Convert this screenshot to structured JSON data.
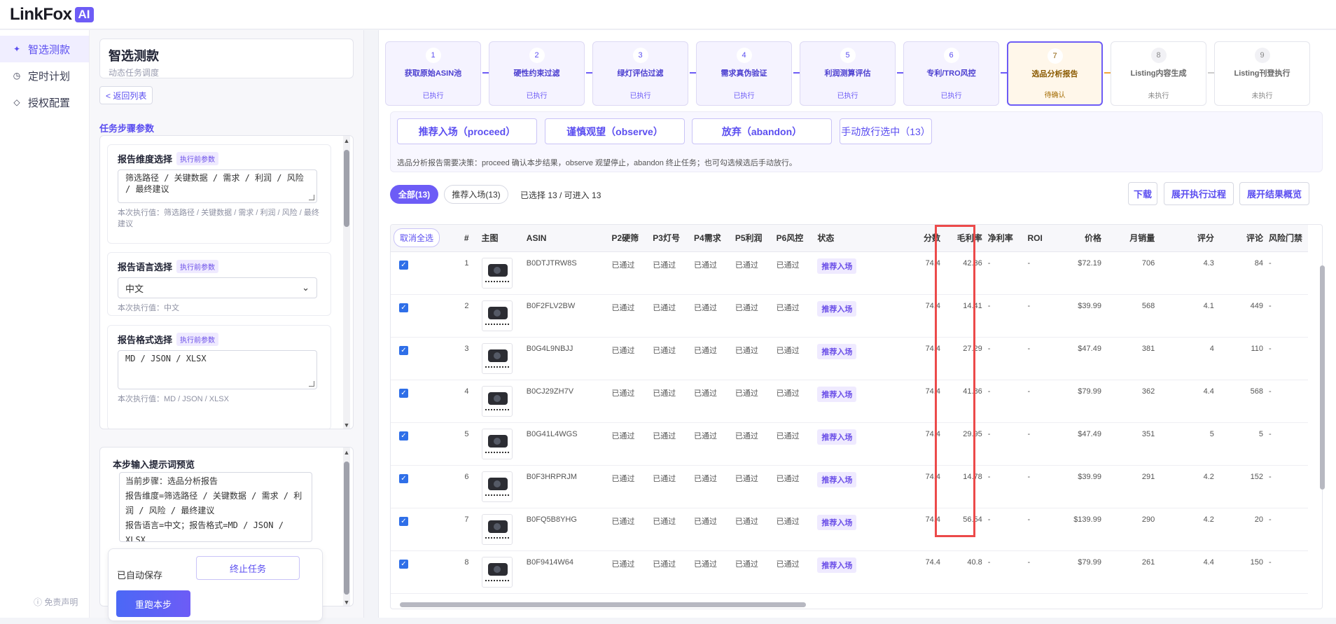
{
  "brand": {
    "name": "LinkFox",
    "badge": "AI"
  },
  "nav": {
    "items": [
      {
        "label": "智选测款",
        "icon": "sparkle-icon",
        "active": true
      },
      {
        "label": "定时计划",
        "icon": "clock-icon",
        "active": false
      },
      {
        "label": "授权配置",
        "icon": "diamond-icon",
        "active": false
      }
    ],
    "footer": "ⓘ 免责声明"
  },
  "task": {
    "title": "智选测款",
    "subtitle": "动态任务调度",
    "back_label": "< 返回列表",
    "section_label": "任务步骤参数"
  },
  "params": [
    {
      "label": "报告维度选择",
      "tag": "执行前参数",
      "value": "筛选路径 / 关键数据 / 需求 / 利润 / 风险 / 最终建议",
      "hint": "本次执行值：筛选路径 / 关键数据 / 需求 / 利润 / 风险 / 最终建议"
    },
    {
      "label": "报告语言选择",
      "tag": "执行前参数",
      "value": "中文",
      "hint": "本次执行值：中文"
    },
    {
      "label": "报告格式选择",
      "tag": "执行前参数",
      "value": "MD / JSON / XLSX",
      "hint": "本次执行值：MD / JSON / XLSX"
    }
  ],
  "preview": {
    "title": "本步输入提示词预览",
    "text": "当前步骤：选品分析报告\n报告维度=筛选路径 / 关键数据 / 需求 / 利润 / 风险 / 最终建议\n报告语言=中文；报告格式=MD / JSON / XLSX",
    "autosave": "已自动保存",
    "stop_label": "终止任务",
    "rerun_label": "重跑本步"
  },
  "steps": [
    {
      "num": "1",
      "name": "获取原始ASIN池",
      "status": "已执行",
      "state": "done"
    },
    {
      "num": "2",
      "name": "硬性约束过滤",
      "status": "已执行",
      "state": "done"
    },
    {
      "num": "3",
      "name": "绿灯评估过滤",
      "status": "已执行",
      "state": "done"
    },
    {
      "num": "4",
      "name": "需求真伪验证",
      "status": "已执行",
      "state": "done"
    },
    {
      "num": "5",
      "name": "利润测算评估",
      "status": "已执行",
      "state": "done"
    },
    {
      "num": "6",
      "name": "专利/TRO风控",
      "status": "已执行",
      "state": "done"
    },
    {
      "num": "7",
      "name": "选品分析报告",
      "status": "待确认",
      "state": "current"
    },
    {
      "num": "8",
      "name": "Listing内容生成",
      "status": "未执行",
      "state": "pending"
    },
    {
      "num": "9",
      "name": "Listing刊登执行",
      "status": "未执行",
      "state": "pending"
    }
  ],
  "decision": {
    "buttons": [
      "推荐入场（proceed）",
      "谨慎观望（observe）",
      "放弃（abandon）",
      "手动放行选中（13）"
    ],
    "note": "选品分析报告需要决策：proceed 确认本步结果，observe 观望停止，abandon 终止任务；也可勾选候选后手动放行。"
  },
  "filters": {
    "all": "全部(13)",
    "recommended": "推荐入场(13)",
    "selected": "已选择 13 / 可进入 13",
    "download": "下载",
    "expand_process": "展开执行过程",
    "expand_overview": "展开结果概览"
  },
  "table": {
    "deselect_label": "取消全选",
    "headers": [
      "#",
      "主图",
      "ASIN",
      "P2硬筛",
      "P3灯号",
      "P4需求",
      "P5利润",
      "P6风控",
      "状态",
      "分数",
      "毛利率",
      "净利率",
      "ROI",
      "价格",
      "月销量",
      "评分",
      "评论",
      "风险门禁"
    ],
    "rows": [
      {
        "n": "1",
        "asin": "B0DTJTRW8S",
        "p2": "已通过",
        "p3": "已通过",
        "p4": "已通过",
        "p5": "已通过",
        "p6": "已通过",
        "status": "推荐入场",
        "score": "74.4",
        "margin": "42.36",
        "net": "-",
        "roi": "-",
        "price": "$72.19",
        "sales": "706",
        "rating": "4.3",
        "reviews": "84",
        "risk": "-"
      },
      {
        "n": "2",
        "asin": "B0F2FLV2BW",
        "p2": "已通过",
        "p3": "已通过",
        "p4": "已通过",
        "p5": "已通过",
        "p6": "已通过",
        "status": "推荐入场",
        "score": "74.4",
        "margin": "14.41",
        "net": "-",
        "roi": "-",
        "price": "$39.99",
        "sales": "568",
        "rating": "4.1",
        "reviews": "449",
        "risk": "-"
      },
      {
        "n": "3",
        "asin": "B0G4L9NBJJ",
        "p2": "已通过",
        "p3": "已通过",
        "p4": "已通过",
        "p5": "已通过",
        "p6": "已通过",
        "status": "推荐入场",
        "score": "74.4",
        "margin": "27.29",
        "net": "-",
        "roi": "-",
        "price": "$47.49",
        "sales": "381",
        "rating": "4",
        "reviews": "110",
        "risk": "-"
      },
      {
        "n": "4",
        "asin": "B0CJ29ZH7V",
        "p2": "已通过",
        "p3": "已通过",
        "p4": "已通过",
        "p5": "已通过",
        "p6": "已通过",
        "status": "推荐入场",
        "score": "74.4",
        "margin": "41.86",
        "net": "-",
        "roi": "-",
        "price": "$79.99",
        "sales": "362",
        "rating": "4.4",
        "reviews": "568",
        "risk": "-"
      },
      {
        "n": "5",
        "asin": "B0G41L4WGS",
        "p2": "已通过",
        "p3": "已通过",
        "p4": "已通过",
        "p5": "已通过",
        "p6": "已通过",
        "status": "推荐入场",
        "score": "74.4",
        "margin": "29.95",
        "net": "-",
        "roi": "-",
        "price": "$47.49",
        "sales": "351",
        "rating": "5",
        "reviews": "5",
        "risk": "-"
      },
      {
        "n": "6",
        "asin": "B0F3HRPRJM",
        "p2": "已通过",
        "p3": "已通过",
        "p4": "已通过",
        "p5": "已通过",
        "p6": "已通过",
        "status": "推荐入场",
        "score": "74.4",
        "margin": "14.78",
        "net": "-",
        "roi": "-",
        "price": "$39.99",
        "sales": "291",
        "rating": "4.2",
        "reviews": "152",
        "risk": "-"
      },
      {
        "n": "7",
        "asin": "B0FQ5B8YHG",
        "p2": "已通过",
        "p3": "已通过",
        "p4": "已通过",
        "p5": "已通过",
        "p6": "已通过",
        "status": "推荐入场",
        "score": "74.4",
        "margin": "56.54",
        "net": "-",
        "roi": "-",
        "price": "$139.99",
        "sales": "290",
        "rating": "4.2",
        "reviews": "20",
        "risk": "-"
      },
      {
        "n": "8",
        "asin": "B0F9414W64",
        "p2": "已通过",
        "p3": "已通过",
        "p4": "已通过",
        "p5": "已通过",
        "p6": "已通过",
        "status": "推荐入场",
        "score": "74.4",
        "margin": "40.8",
        "net": "-",
        "roi": "-",
        "price": "$79.99",
        "sales": "261",
        "rating": "4.4",
        "reviews": "150",
        "risk": "-"
      }
    ]
  },
  "colors": {
    "accent": "#6d5cf6",
    "highlight": "#ec4a4a",
    "checkbox": "#2f6fe8"
  }
}
